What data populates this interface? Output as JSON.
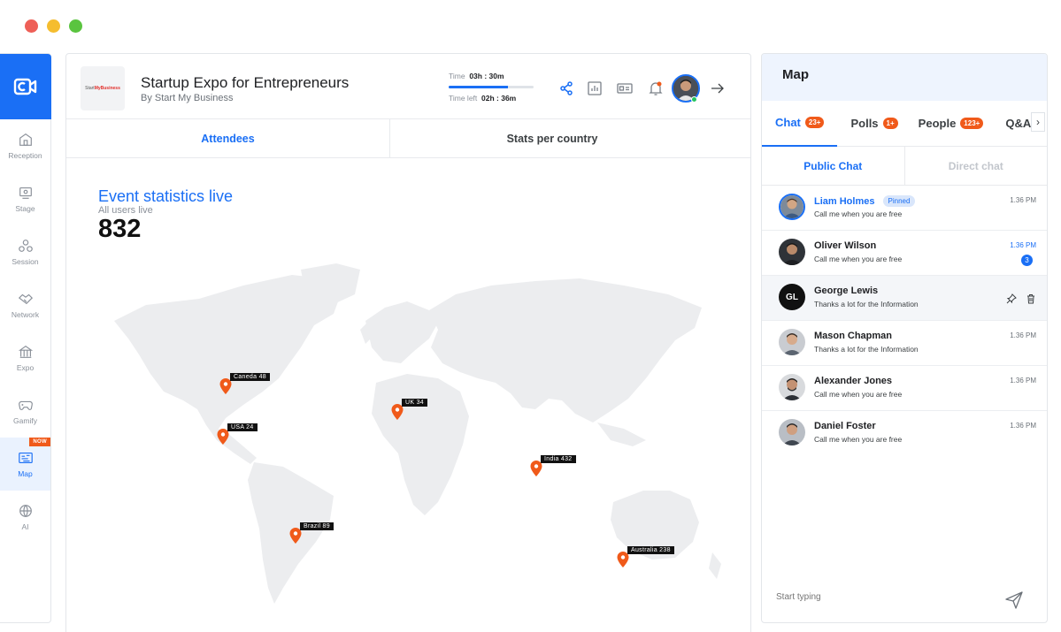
{
  "colors": {
    "accent": "#1a6ff5",
    "badge": "#f05a1a",
    "pin": "#f05a1a"
  },
  "window_dots": [
    "#ee5f57",
    "#f5bd2f",
    "#5ac43f"
  ],
  "nav": {
    "items": [
      {
        "label": "Reception",
        "icon": "reception-icon"
      },
      {
        "label": "Stage",
        "icon": "stage-icon"
      },
      {
        "label": "Session",
        "icon": "session-icon"
      },
      {
        "label": "Network",
        "icon": "handshake-icon"
      },
      {
        "label": "Expo",
        "icon": "expo-icon"
      },
      {
        "label": "Gamify",
        "icon": "gamepad-icon"
      },
      {
        "label": "Map",
        "icon": "map-icon",
        "badge": "NOW"
      },
      {
        "label": "AI",
        "icon": "ai-icon"
      }
    ]
  },
  "event": {
    "logo_a": "Start",
    "logo_b": "MyBusiness",
    "title": "Startup Expo for Entrepreneurs",
    "subtitle": "By Start My Business",
    "time_label": "Time",
    "time_value": "03h : 30m",
    "time_left_label": "Time left",
    "time_left_value": "02h : 36m",
    "time_progress": 0.7
  },
  "subtabs": {
    "attendees": "Attendees",
    "stats": "Stats per country"
  },
  "stats": {
    "title": "Event statistics live",
    "sub": "All users live",
    "value": "832"
  },
  "map_pins": [
    {
      "label": "Caneda 48"
    },
    {
      "label": "USA 24"
    },
    {
      "label": "UK 34"
    },
    {
      "label": "India 432"
    },
    {
      "label": "Brazil 89"
    },
    {
      "label": "Australia 238"
    }
  ],
  "right": {
    "title": "Map",
    "tabs": [
      {
        "label": "Chat",
        "count": "23+"
      },
      {
        "label": "Polls",
        "count": "1+"
      },
      {
        "label": "People",
        "count": "123+"
      },
      {
        "label": "Q&A",
        "count": ""
      }
    ],
    "tab_next": "›",
    "chat_tabs": {
      "public": "Public Chat",
      "direct": "Direct chat"
    },
    "pinned_label": "Pinned",
    "messages": [
      {
        "name": "Liam Holmes",
        "text": "Call me when you are free",
        "time": "1.36 PM"
      },
      {
        "name": "Oliver Wilson",
        "text": "Call me when you are free",
        "time": "1.36 PM",
        "unread": "3"
      },
      {
        "name": "George Lewis",
        "initials": "GL",
        "text": "Thanks a lot for the Information"
      },
      {
        "name": "Mason Chapman",
        "text": "Thanks a lot for the Information",
        "time": "1.36 PM"
      },
      {
        "name": "Alexander Jones",
        "text": "Call me when you are free",
        "time": "1.36 PM"
      },
      {
        "name": "Daniel Foster",
        "text": "Call me when you are free",
        "time": "1.36 PM"
      }
    ],
    "compose_placeholder": "Start typing"
  }
}
